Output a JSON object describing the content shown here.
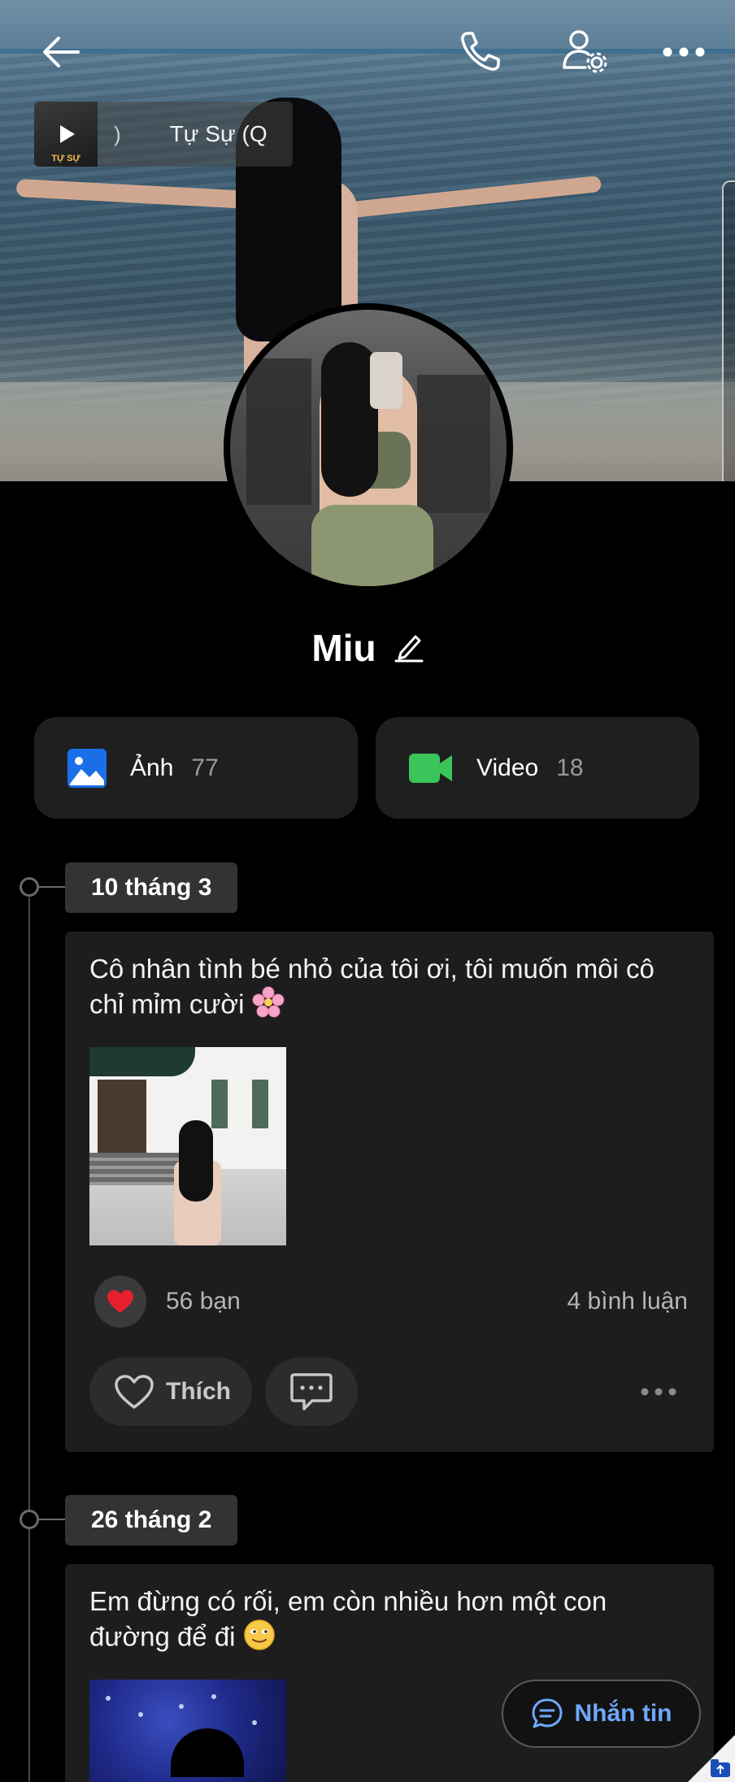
{
  "header": {
    "back_icon": "arrow-left-icon",
    "call_icon": "phone-icon",
    "settings_icon": "user-settings-icon",
    "more_icon": "more-horizontal-icon"
  },
  "music": {
    "thumb_label": "TỰ SỰ",
    "paren": ")",
    "title": "Tự Sự (Q"
  },
  "profile": {
    "name": "Miu",
    "edit_icon": "pencil-icon"
  },
  "media": {
    "photos": {
      "label": "Ảnh",
      "count": "77",
      "icon": "image-icon",
      "color": "#1a6fe8"
    },
    "videos": {
      "label": "Video",
      "count": "18",
      "icon": "video-icon",
      "color": "#3ac45a"
    }
  },
  "posts": [
    {
      "date": "10 tháng 3",
      "text": "Cô nhân tình bé nhỏ của tôi ơi, tôi muốn môi cô chỉ mỉm cười",
      "emoji": "cherry-blossom",
      "likes": "56 bạn",
      "comments": "4 bình luận",
      "like_label": "Thích"
    },
    {
      "date": "26 tháng 2",
      "text": "Em đừng có rối, em còn nhiều hơn một con đường để đi",
      "emoji": "smiling-face"
    }
  ],
  "fab": {
    "label": "Nhắn tin",
    "accent": "#6ea8ff"
  }
}
